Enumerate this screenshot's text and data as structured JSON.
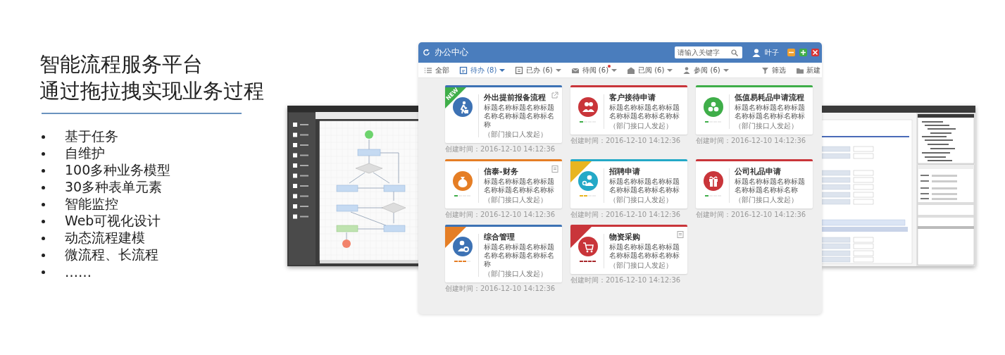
{
  "slide": {
    "title_lines": [
      "智能流程服务平台",
      "通过拖拉拽实现业务过程"
    ],
    "bullets": [
      "基于任务",
      "自维护",
      "100多种业务模型",
      "30多种表单元素",
      "智能监控",
      "Web可视化设计",
      "动态流程建模",
      "微流程、长流程",
      "……"
    ]
  },
  "background_windows": [
    {
      "kind": "flow-designer"
    },
    {
      "kind": "form-designer"
    }
  ],
  "window": {
    "title": "办公中心",
    "search": {
      "placeholder": "请输入关键字"
    },
    "user": "叶子",
    "tabs": [
      {
        "label": "全部",
        "selected": false,
        "dropdown": false,
        "unread_dot": false
      },
      {
        "label": "待办 (8)",
        "selected": true,
        "dropdown": true,
        "unread_dot": false
      },
      {
        "label": "已办 (6)",
        "selected": false,
        "dropdown": true,
        "unread_dot": false
      },
      {
        "label": "待阅 (6)",
        "selected": false,
        "dropdown": true,
        "unread_dot": true
      },
      {
        "label": "已阅 (6)",
        "selected": false,
        "dropdown": true,
        "unread_dot": false
      },
      {
        "label": "参阅 (6)",
        "selected": false,
        "dropdown": true,
        "unread_dot": false
      }
    ],
    "actions": [
      {
        "label": "筛选"
      },
      {
        "label": "新建"
      }
    ],
    "cards": [
      {
        "title": "外出提前报备流程",
        "description": "标题名称标题名称标题名称名称标题名称标名称",
        "requester": "（部门接口人发起）",
        "created": "创建时间：2016-12-10 14:12:36",
        "color": "#3d72b4",
        "ribbon": {
          "text": "NEW",
          "color": "#3fae49"
        }
      },
      {
        "title": "客户接待申请",
        "description": "标题名称标题名称标题名称标题名称标名称标",
        "requester": "（部门接口人发起）",
        "created": "创建时间：2016-12-10 14:12:36",
        "color": "#c9353a",
        "progress": {
          "level": 0.25,
          "color": "#3fae49"
        }
      },
      {
        "title": "低值易耗品申请流程",
        "description": "标题名称标题名称标题名称标题名称标名称标",
        "requester": "（部门接口人发起）",
        "created": "创建时间：2016-12-10 14:12:36",
        "color": "#3fae49",
        "progress": {
          "level": 0.25,
          "color": "#3fae49"
        }
      },
      {
        "title": "信泰-财务",
        "description": "标题名称标题名称标题名称标题名称标名称标",
        "requester": "（部门接口人发起）",
        "created": "创建时间：2016-12-10 14:12:36",
        "color": "#e57e25",
        "progress": {
          "level": 0.25,
          "color": "#3fae49"
        }
      },
      {
        "title": "招聘申请",
        "description": "标题名称标题名称标题名称标题名称标名称标",
        "requester": "（部门接口人发起）",
        "created": "创建时间：2016-12-10 14:12:36",
        "color": "#24a9c7",
        "progress": {
          "level": 0.5,
          "color": "#e8b520"
        },
        "ribbon": {
          "color": "#e8b520"
        }
      },
      {
        "title": "公司礼品申请",
        "description": "标题名称标题名称标题名称标题名称标名称",
        "requester": "（部门接口人发起）",
        "created": "创建时间：2016-12-10 14:12:36",
        "color": "#c9353a",
        "progress": {
          "level": 0.25,
          "color": "#3fae49"
        }
      },
      {
        "title": "综合管理",
        "description": "标题名称标题名称标题名称名称标题名称标名称",
        "requester": "（部门接口人发起）",
        "created": "创建时间：2016-12-10 14:12:36",
        "color": "#3d72b4",
        "progress": {
          "level": 0.75,
          "color": "#e57e25"
        },
        "ribbon": {
          "color": "#e57e25"
        }
      },
      {
        "title": "物资采购",
        "description": "标题名称标题名称标题名称标题名称标名称标",
        "requester": "（部门接口人发起）",
        "created": "创建时间：2016-12-10 14:12:36",
        "color": "#c9353a",
        "progress": {
          "level": 1,
          "color": "#a8282c"
        },
        "ribbon": {
          "color": "#c9353a"
        }
      }
    ]
  }
}
